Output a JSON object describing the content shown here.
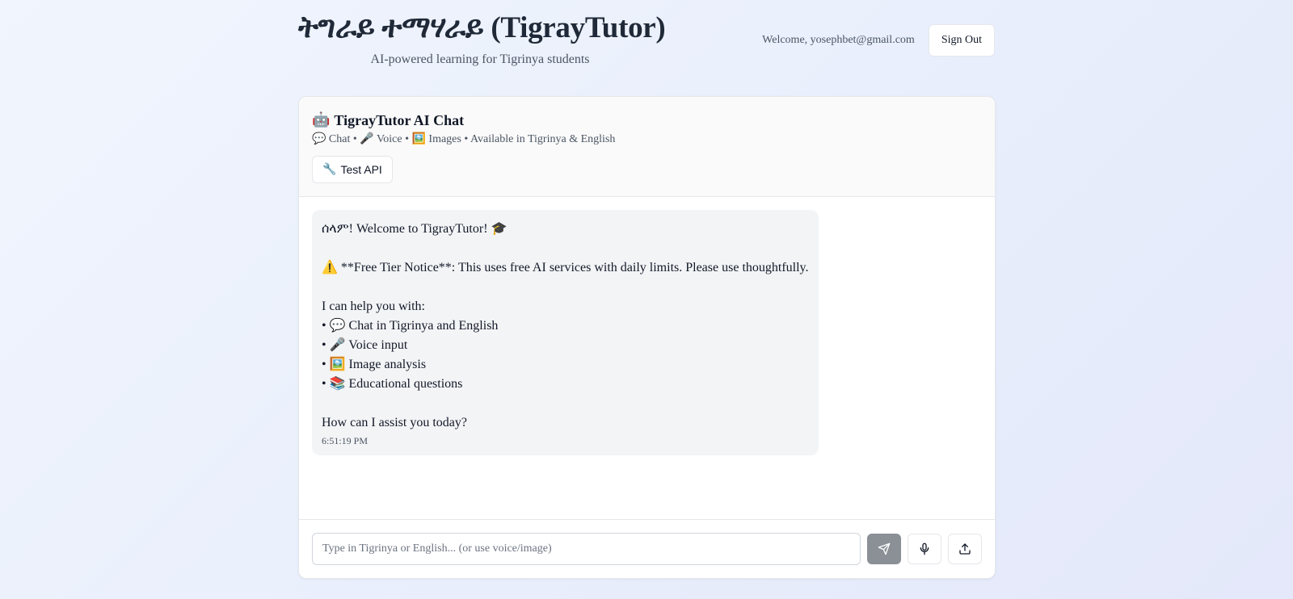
{
  "header": {
    "title": "ትግራይ ተማሃራይ (TigrayTutor)",
    "subtitle": "AI-powered learning for Tigrinya students",
    "welcome": "Welcome, yosephbet@gmail.com",
    "sign_out_label": "Sign Out"
  },
  "chat": {
    "title_icon": "🤖",
    "title": "TigrayTutor AI Chat",
    "features": "💬 Chat • 🎤 Voice • 🖼️ Images • Available in Tigrinya & English",
    "test_api_icon": "🔧",
    "test_api_label": "Test API",
    "message": {
      "greeting": "ሰላም! Welcome to TigrayTutor! 🎓",
      "notice": "⚠️ **Free Tier Notice**: This uses free AI services with daily limits. Please use thoughtfully.",
      "help_intro": "I can help you with:",
      "help_items": [
        "• 💬 Chat in Tigrinya and English",
        "• 🎤 Voice input",
        "• 🖼️ Image analysis",
        "• 📚 Educational questions"
      ],
      "closing": "How can I assist you today?",
      "time": "6:51:19 PM"
    },
    "input_placeholder": "Type in Tigrinya or English... (or use voice/image)",
    "send_icon": "send-icon",
    "mic_icon": "microphone-icon",
    "upload_icon": "upload-icon"
  },
  "colors": {
    "send_button": "#8b8f96",
    "bubble": "#f3f4f6",
    "header_bg": "#fafafa"
  }
}
